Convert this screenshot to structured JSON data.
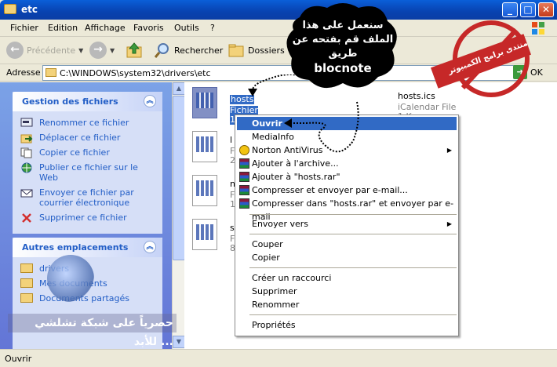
{
  "window": {
    "title": "etc",
    "min": "_",
    "max": "□",
    "close": "✕"
  },
  "menu": [
    "Fichier",
    "Edition",
    "Affichage",
    "Favoris",
    "Outils",
    "?"
  ],
  "toolbar": {
    "back": "Précédente",
    "search": "Rechercher",
    "folders": "Dossiers"
  },
  "address": {
    "label": "Adresse",
    "path": "C:\\WINDOWS\\system32\\drivers\\etc",
    "go": "OK"
  },
  "left_panel": {
    "file_tasks": {
      "title": "Gestion des fichiers",
      "items": [
        "Renommer ce fichier",
        "Déplacer ce fichier",
        "Copier ce fichier",
        "Publier ce fichier sur le Web",
        "Envoyer ce fichier par courrier électronique",
        "Supprimer ce fichier"
      ]
    },
    "other_places": {
      "title": "Autres emplacements",
      "items": [
        "drivers",
        "Mes documents",
        "Documents partagés"
      ]
    }
  },
  "files": [
    {
      "name": "hosts",
      "sub": "Fichier",
      "sub2": "1 Ko"
    },
    {
      "name": "hosts.ics",
      "sub": "iCalendar File",
      "sub2": "1 Ko"
    },
    {
      "name": "l",
      "sub": "F",
      "sub2": "2"
    },
    {
      "name": "n",
      "sub": "F",
      "sub2": "1"
    },
    {
      "name": "s",
      "sub": "F",
      "sub2": "8"
    }
  ],
  "context_menu": {
    "items": [
      "Ouvrir",
      "MediaInfo",
      "Norton AntiVirus",
      "Ajouter à l'archive...",
      "Ajouter à \"hosts.rar\"",
      "Compresser et envoyer par e-mail...",
      "Compresser dans \"hosts.rar\" et envoyer par e-mail",
      "Envoyer vers",
      "Couper",
      "Copier",
      "Créer un raccourci",
      "Supprimer",
      "Renommer",
      "Propriétés"
    ]
  },
  "status": "Ouvrir",
  "overlay": {
    "bubble_line1": "سنعمل على هذا",
    "bubble_line2": "الملف قم بفتحه عن",
    "bubble_line3": "طريق",
    "bubble_line4": "blocnote",
    "stamp": "منتدى برامج الكمبيوتر",
    "watermark": "حصرياً على شبكة تشلشي للأبد ..."
  }
}
